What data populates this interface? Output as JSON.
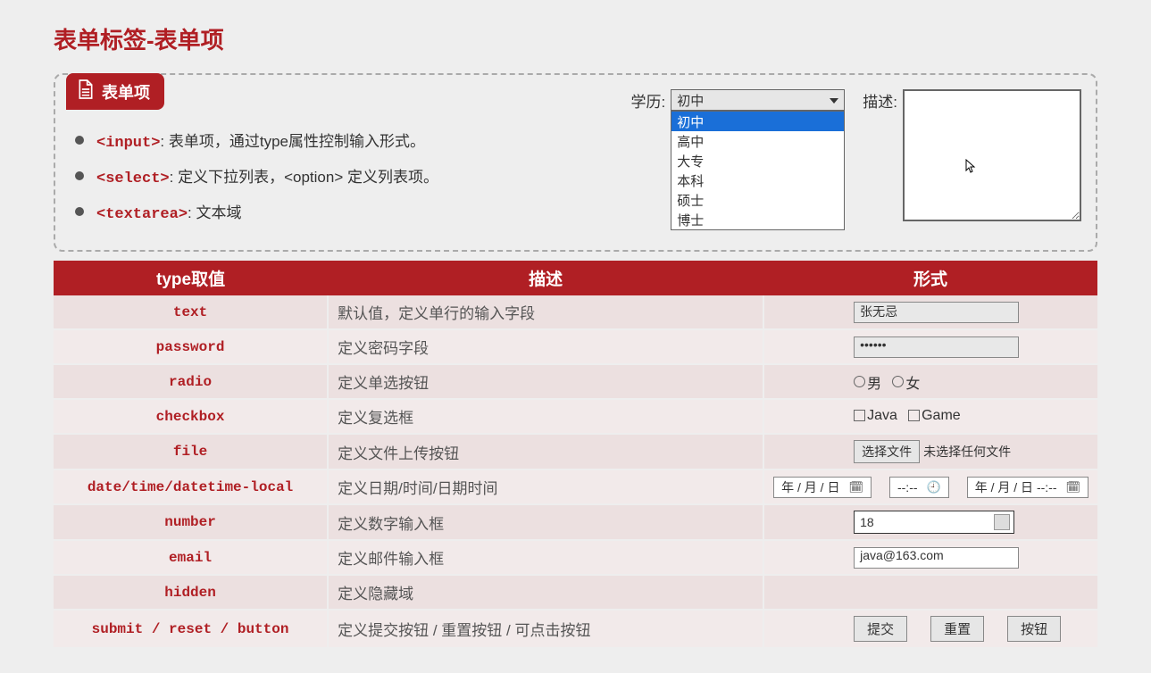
{
  "page_title": "表单标签-表单项",
  "badge_label": "表单项",
  "bullets": [
    {
      "code": "<input>",
      "suffix": ": 表单项，通过type属性控制输入形式。"
    },
    {
      "code": "<select>",
      "suffix": ": 定义下拉列表，<option> 定义列表项。"
    },
    {
      "code": "<textarea>",
      "suffix": ": 文本域"
    }
  ],
  "select_field": {
    "label": "学历:",
    "value": "初中",
    "options": [
      "初中",
      "高中",
      "大专",
      "本科",
      "硕士",
      "博士"
    ],
    "selected_index": 0
  },
  "textarea_field": {
    "label": "描述:",
    "value": ""
  },
  "table": {
    "headers": [
      "type取值",
      "描述",
      "形式"
    ],
    "rows": [
      {
        "type": "text",
        "desc": "默认值，定义单行的输入字段"
      },
      {
        "type": "password",
        "desc": "定义密码字段"
      },
      {
        "type": "radio",
        "desc": "定义单选按钮"
      },
      {
        "type": "checkbox",
        "desc": "定义复选框"
      },
      {
        "type": "file",
        "desc": "定义文件上传按钮"
      },
      {
        "type": "date/time/datetime-local",
        "desc": "定义日期/时间/日期时间"
      },
      {
        "type": "number",
        "desc": "定义数字输入框"
      },
      {
        "type": "email",
        "desc": "定义邮件输入框"
      },
      {
        "type": "hidden",
        "desc": "定义隐藏域"
      },
      {
        "type": "submit / reset / button",
        "desc": "定义提交按钮 / 重置按钮 / 可点击按钮"
      }
    ]
  },
  "samples": {
    "text_value": "张无忌",
    "password_value": "••••••",
    "radio_options": [
      "男",
      "女"
    ],
    "checkbox_options": [
      "Java",
      "Game"
    ],
    "file_button": "选择文件",
    "file_status": "未选择任何文件",
    "date_value": "年 / 月 / 日",
    "time_value": "--:--",
    "datetime_value": "年 / 月 / 日 --:--",
    "number_value": "18",
    "email_value": "java@163.com",
    "buttons": [
      "提交",
      "重置",
      "按钮"
    ]
  }
}
